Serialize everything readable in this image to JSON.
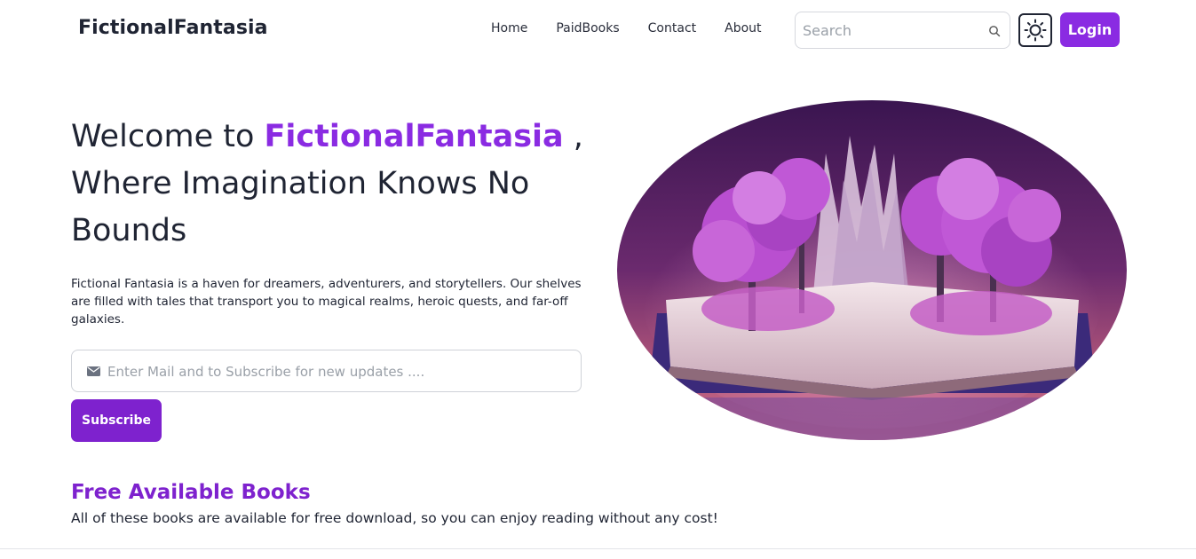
{
  "header": {
    "brand": "FictionalFantasia",
    "nav": [
      {
        "label": "Home"
      },
      {
        "label": "PaidBooks"
      },
      {
        "label": "Contact"
      },
      {
        "label": "About"
      }
    ],
    "search": {
      "placeholder": "Search"
    },
    "theme_toggle_icon": "sun-icon",
    "login_label": "Login"
  },
  "hero": {
    "title_prefix": "Welcome to ",
    "title_accent": "FictionalFantasia",
    "title_suffix": " , Where Imagination Knows No Bounds",
    "description": "Fictional Fantasia is a haven for dreamers, adventurers, and storytellers. Our shelves are filled with tales that transport you to magical realms, heroic quests, and far-off galaxies.",
    "subscribe_placeholder": "Enter Mail and to Subscribe for new updates ....",
    "subscribe_label": "Subscribe",
    "image_subject": "open book with purple trees"
  },
  "free_books": {
    "title": "Free Available Books",
    "subtitle": "All of these books are available for free download, so you can enjoy reading without any cost!"
  },
  "colors": {
    "accent": "#8a2be2",
    "accent_dark": "#7e22ce",
    "text": "#1f2433"
  }
}
